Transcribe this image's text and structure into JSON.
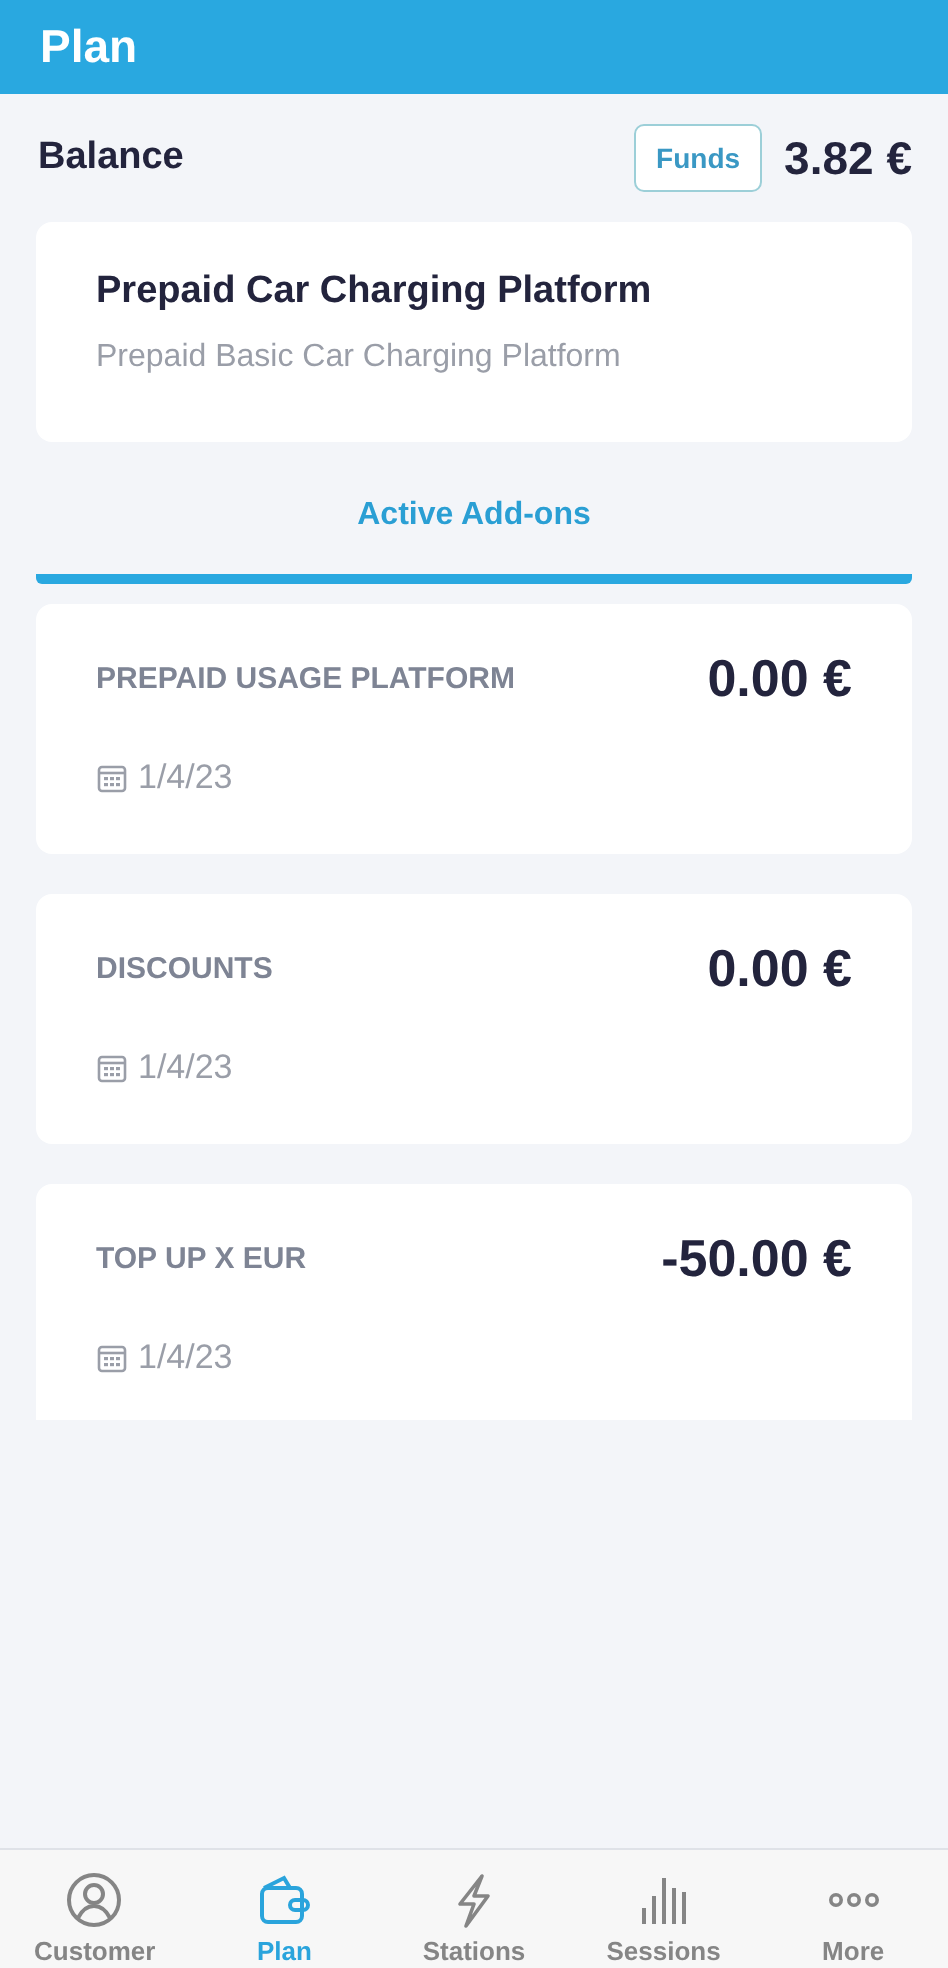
{
  "header": {
    "title": "Plan"
  },
  "balance": {
    "label": "Balance",
    "funds_button": "Funds",
    "amount": "3.82 €"
  },
  "plan": {
    "title": "Prepaid Car Charging Platform",
    "subtitle": "Prepaid Basic Car Charging Platform"
  },
  "addons_tab": {
    "label": "Active Add-ons",
    "selected": true
  },
  "addons": [
    {
      "name": "PREPAID USAGE PLATFORM",
      "amount": "0.00 €",
      "date": "1/4/23"
    },
    {
      "name": "DISCOUNTS",
      "amount": "0.00 €",
      "date": "1/4/23"
    },
    {
      "name": "TOP UP X EUR",
      "amount": "-50.00 €",
      "date": "1/4/23"
    }
  ],
  "nav": [
    {
      "label": "Customer",
      "selected": false
    },
    {
      "label": "Plan",
      "selected": true
    },
    {
      "label": "Stations",
      "selected": false
    },
    {
      "label": "Sessions",
      "selected": false
    },
    {
      "label": "More",
      "selected": false
    }
  ]
}
